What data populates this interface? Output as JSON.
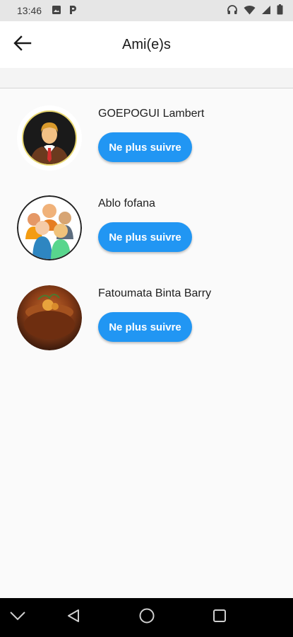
{
  "status_bar": {
    "time": "13:46",
    "left_icons": [
      "image-icon",
      "p-icon"
    ],
    "right_icons": [
      "headphones-icon",
      "wifi-icon",
      "signal-icon",
      "battery-icon"
    ]
  },
  "app_bar": {
    "title": "Ami(e)s",
    "back_icon": "arrow-left-icon"
  },
  "friends": [
    {
      "name": "GOEPOGUI Lambert",
      "button_label": "Ne plus suivre",
      "avatar": "businessman-avatar"
    },
    {
      "name": "Ablo fofana",
      "button_label": "Ne plus suivre",
      "avatar": "group-avatar"
    },
    {
      "name": "Fatoumata Binta Barry",
      "button_label": "Ne plus suivre",
      "avatar": "food-photo-avatar"
    }
  ],
  "nav_bar": {
    "items": [
      "chevron-down-icon",
      "back-triangle-icon",
      "home-circle-icon",
      "recents-square-icon"
    ]
  },
  "colors": {
    "accent": "#2196f3",
    "background": "#fafafa",
    "status_bar": "#e6e6e6",
    "nav_bar": "#000000"
  }
}
